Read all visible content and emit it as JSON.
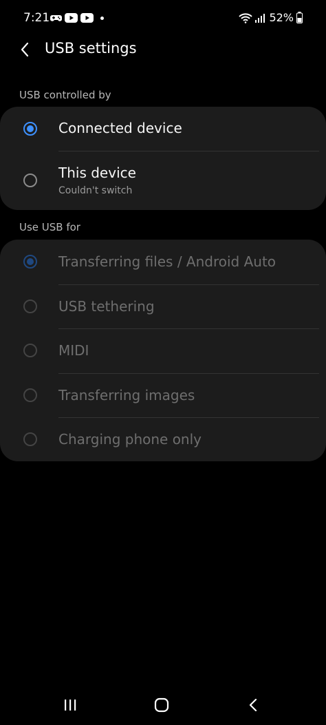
{
  "status_bar": {
    "time": "7:21",
    "battery": "52%",
    "notification_icons": [
      "game-controller-icon",
      "youtube-icon",
      "youtube-icon"
    ],
    "system_icons": [
      "wifi-icon",
      "signal-icon",
      "battery-icon"
    ]
  },
  "header": {
    "title": "USB settings",
    "back_icon": "back-arrow-icon"
  },
  "sections": {
    "controlled_by": {
      "title": "USB controlled by",
      "options": [
        {
          "label": "Connected device",
          "selected": true
        },
        {
          "label": "This device",
          "subtitle": "Couldn't switch",
          "selected": false
        }
      ]
    },
    "use_for": {
      "title": "Use USB for",
      "options": [
        {
          "label": "Transferring files / Android Auto",
          "selected": true,
          "enabled": false
        },
        {
          "label": "USB tethering",
          "selected": false,
          "enabled": false
        },
        {
          "label": "MIDI",
          "selected": false,
          "enabled": false
        },
        {
          "label": "Transferring images",
          "selected": false,
          "enabled": false
        },
        {
          "label": "Charging phone only",
          "selected": false,
          "enabled": false
        }
      ]
    }
  },
  "nav_bar": {
    "buttons": [
      "recent-apps-icon",
      "home-icon",
      "back-icon"
    ]
  },
  "colors": {
    "accent": "#3e91ff",
    "card_background": "#1c1c1c",
    "background": "#000000"
  }
}
